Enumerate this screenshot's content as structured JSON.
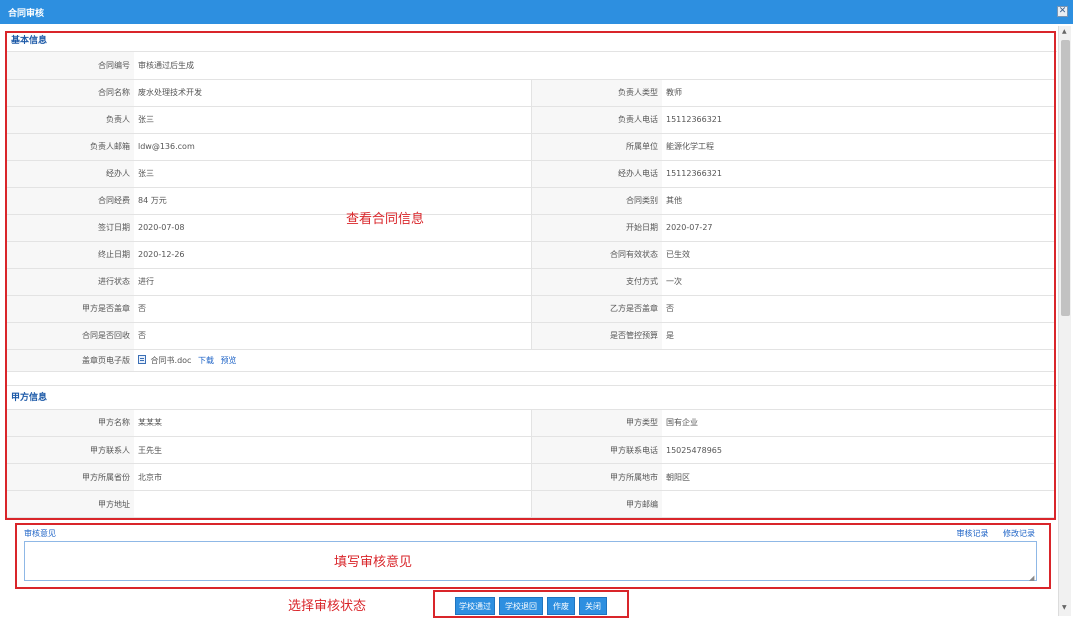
{
  "window": {
    "title": "合同审核",
    "close_glyph": "✕"
  },
  "basic": {
    "title": "基本信息",
    "rows": [
      {
        "l1": "合同编号",
        "v1": "审核通过后生成"
      },
      {
        "l1": "合同名称",
        "v1": "废水处理技术开发",
        "l2": "负责人类型",
        "v2": "教师"
      },
      {
        "l1": "负责人",
        "v1": "张三",
        "l2": "负责人电话",
        "v2": "15112366321"
      },
      {
        "l1": "负责人邮箱",
        "v1": "ldw@136.com",
        "l2": "所属单位",
        "v2": "能源化学工程"
      },
      {
        "l1": "经办人",
        "v1": "张三",
        "l2": "经办人电话",
        "v2": "15112366321"
      },
      {
        "l1": "合同经费",
        "v1": "84 万元",
        "l2": "合同类别",
        "v2": "其他"
      },
      {
        "l1": "签订日期",
        "v1": "2020-07-08",
        "l2": "开始日期",
        "v2": "2020-07-27"
      },
      {
        "l1": "终止日期",
        "v1": "2020-12-26",
        "l2": "合同有效状态",
        "v2": "已生效"
      },
      {
        "l1": "进行状态",
        "v1": "进行",
        "l2": "支付方式",
        "v2": "一次"
      },
      {
        "l1": "甲方是否盖章",
        "v1": "否",
        "l2": "乙方是否盖章",
        "v2": "否"
      },
      {
        "l1": "合同是否回收",
        "v1": "否",
        "l2": "是否管控预算",
        "v2": "是"
      }
    ],
    "file_row": {
      "label": "盖章页电子版",
      "file_name": "合同书.doc",
      "download": "下载",
      "preview": "预览"
    }
  },
  "party_a": {
    "title": "甲方信息",
    "rows": [
      {
        "l1": "甲方名称",
        "v1": "某某某",
        "l2": "甲方类型",
        "v2": "国有企业"
      },
      {
        "l1": "甲方联系人",
        "v1": "王先生",
        "l2": "甲方联系电话",
        "v2": "15025478965"
      },
      {
        "l1": "甲方所属省份",
        "v1": "北京市",
        "l2": "甲方所属地市",
        "v2": "朝阳区"
      },
      {
        "l1": "甲方地址",
        "v1": "",
        "l2": "甲方邮编",
        "v2": ""
      }
    ]
  },
  "opinion": {
    "label": "审核意见",
    "history_link": "审核记录",
    "modify_link": "修改记录",
    "value": ""
  },
  "buttons": {
    "approve": "学校通过",
    "reject": "学校退回",
    "void": "作废",
    "close": "关闭"
  },
  "annotations": {
    "view_contract": "查看合同信息",
    "fill_opinion": "填写审核意见",
    "choose_status": "选择审核状态"
  },
  "colors": {
    "titlebar": "#2d8fe0",
    "button": "#2d8fe0",
    "annotation_red": "#d9252a",
    "section_title": "#1d5aa8"
  }
}
